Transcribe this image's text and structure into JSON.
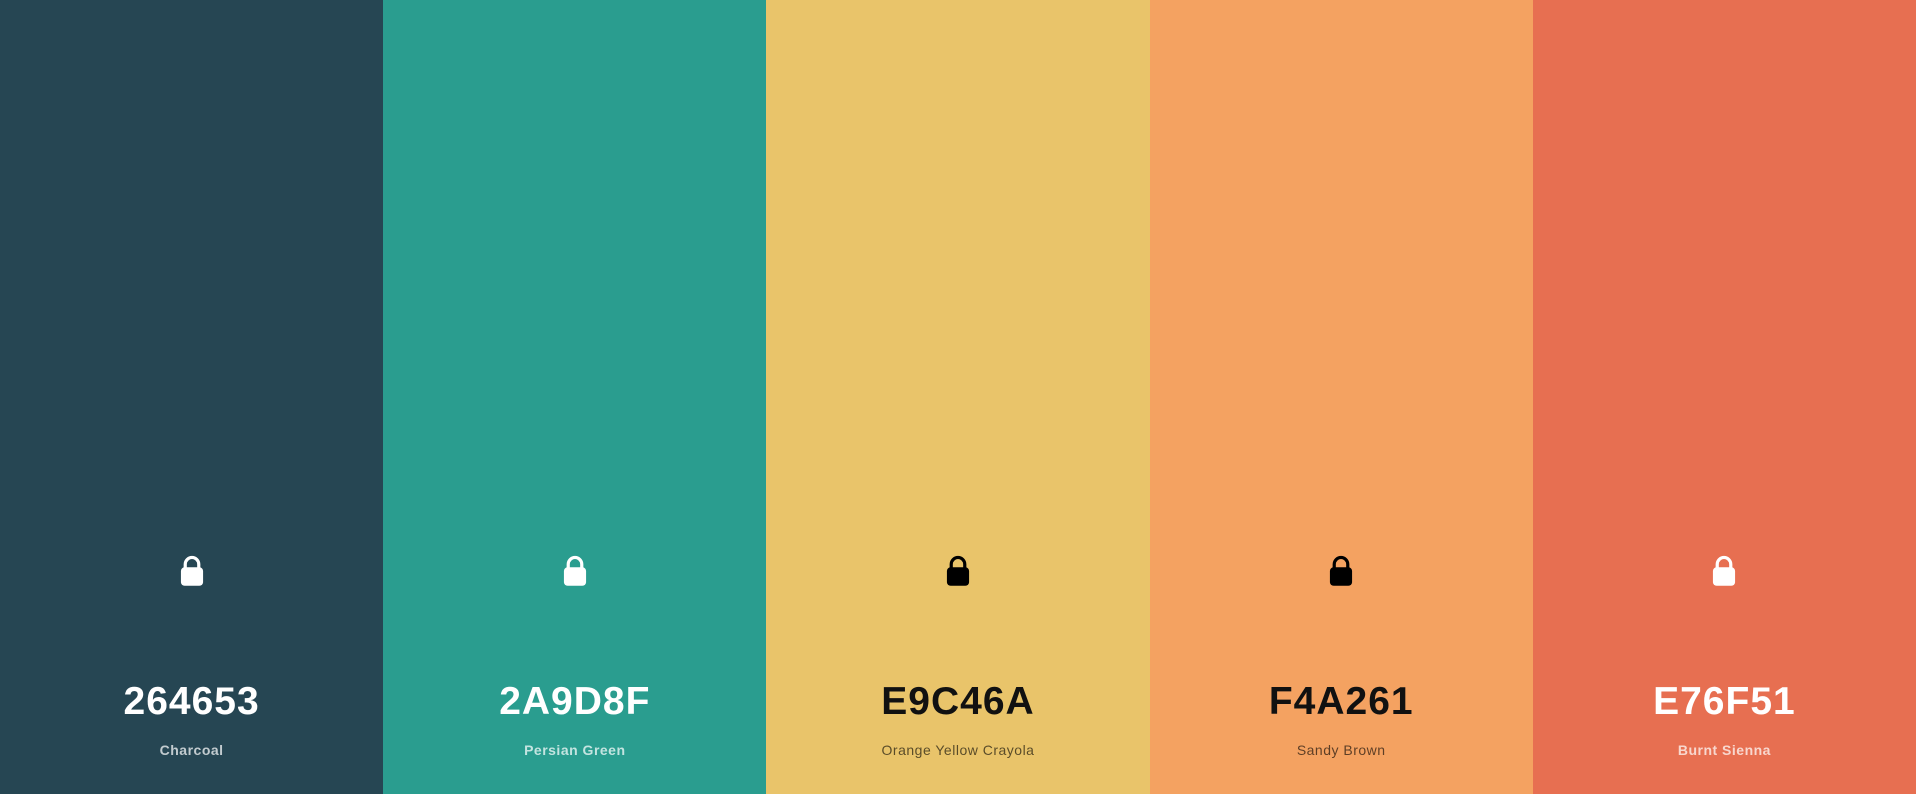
{
  "palette": {
    "colors": [
      {
        "hex": "264653",
        "name": "Charcoal",
        "bg": "#264653",
        "theme": "light",
        "icon": "lock-icon"
      },
      {
        "hex": "2A9D8F",
        "name": "Persian Green",
        "bg": "#2A9D8F",
        "theme": "light",
        "icon": "lock-icon"
      },
      {
        "hex": "E9C46A",
        "name": "Orange Yellow Crayola",
        "bg": "#E9C46A",
        "theme": "dark",
        "icon": "lock-icon"
      },
      {
        "hex": "F4A261",
        "name": "Sandy Brown",
        "bg": "#F4A261",
        "theme": "dark",
        "icon": "lock-icon"
      },
      {
        "hex": "E76F51",
        "name": "Burnt Sienna",
        "bg": "#E76F51",
        "theme": "light",
        "icon": "lock-icon"
      }
    ]
  }
}
